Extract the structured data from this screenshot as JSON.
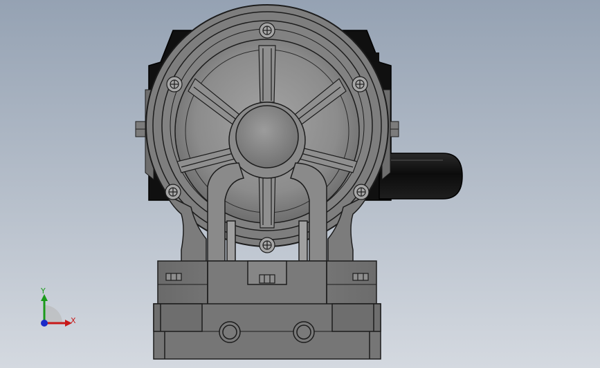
{
  "viewport": {
    "background_top": "#95a2b3",
    "background_bottom": "#d4d9e0"
  },
  "model": {
    "body_color": "#7b7b7b",
    "edge_color": "#1c1c1c",
    "motor_color": "#111111"
  },
  "triad": {
    "x_label": "X",
    "y_label": "Y",
    "x_color": "#c81818",
    "y_color": "#1a9a1a",
    "z_color": "#1a2ac8"
  }
}
